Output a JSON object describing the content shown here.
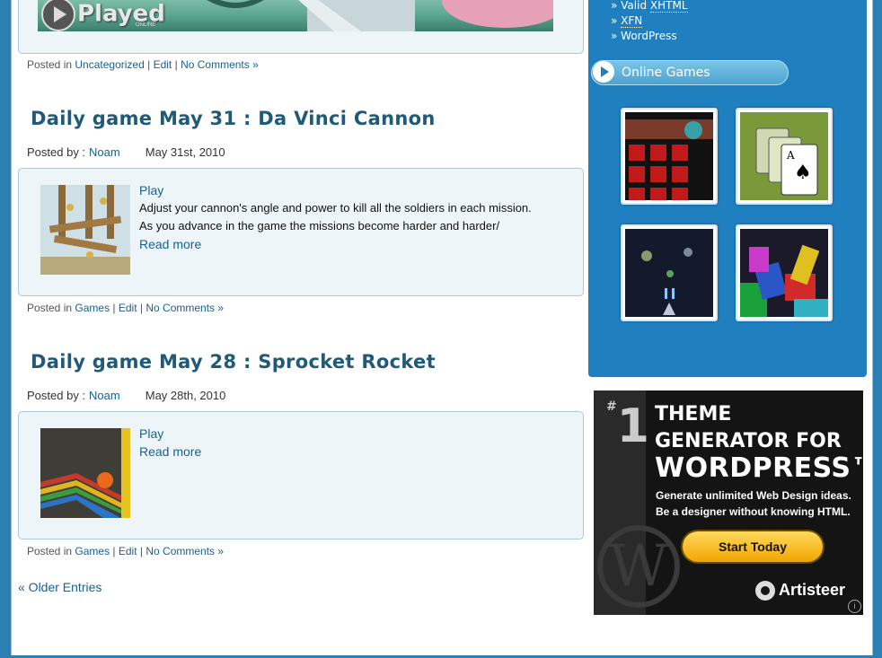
{
  "prev_post": {
    "banner_logo": "Played",
    "banner_sub": "ONLINE",
    "meta": {
      "prefix": "Posted in",
      "category": "Uncategorized",
      "edit": "Edit",
      "comments": "No Comments »"
    }
  },
  "posts": [
    {
      "title": "Daily game May 31 : Da Vinci Cannon",
      "byline_prefix": "Posted by :",
      "author": "Noam",
      "date": "May 31st, 2010",
      "play": "Play",
      "excerpt_line1": "Adjust your cannon's angle and power to kill all the soldiers in each mission.",
      "excerpt_line2": "As you advance in the game the missions become harder and harder/",
      "read_more": "Read more",
      "meta": {
        "prefix": "Posted in",
        "category": "Games",
        "edit": "Edit",
        "comments": "No Comments »"
      }
    },
    {
      "title": "Daily game May 28 : Sprocket Rocket",
      "byline_prefix": "Posted by :",
      "author": "Noam",
      "date": "May 28th, 2010",
      "play": "Play",
      "read_more": "Read more",
      "meta": {
        "prefix": "Posted in",
        "category": "Games",
        "edit": "Edit",
        "comments": "No Comments »"
      }
    }
  ],
  "older_entries": "« Older Entries",
  "sidebar": {
    "links": [
      {
        "prefix": "» Valid ",
        "abbr": "XHTML"
      },
      {
        "prefix": "» ",
        "abbr": "XFN"
      },
      {
        "prefix": "» WordPress",
        "abbr": ""
      }
    ],
    "online_games_heading": "Online Games"
  },
  "ad": {
    "number": "1",
    "hash": "#",
    "line1": "THEME",
    "line2": "GENERATOR FOR",
    "line3": "WORDPRESS™",
    "sub1": "Generate unlimited Web Design ideas.",
    "sub2": "Be a designer without knowing HTML.",
    "button": "Start Today",
    "brand": "Artisteer",
    "info": "i"
  },
  "colors": {
    "link": "#1a5f8f",
    "title": "#1f5a78",
    "sidebar": "#1f7fbf",
    "background": "#2b7fb3"
  }
}
